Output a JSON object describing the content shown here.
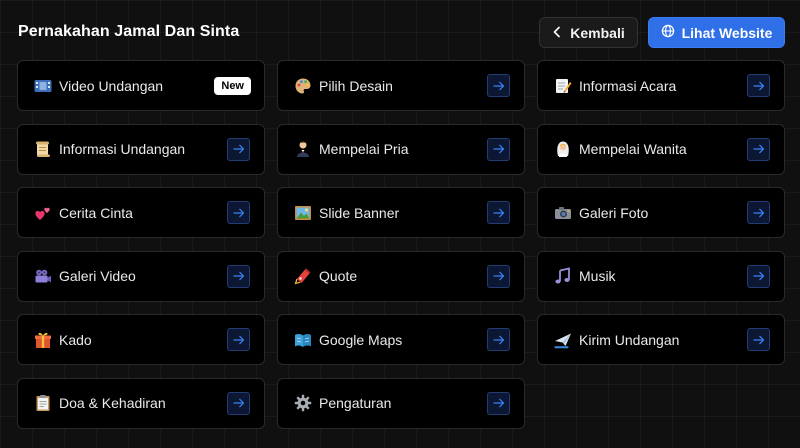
{
  "header": {
    "title": "Pernakahan Jamal Dan Sinta",
    "back_label": "Kembali",
    "website_label": "Lihat Website"
  },
  "colors": {
    "accent": "#2f6fe8",
    "arrow_icon": "#3b82f6",
    "card_background": "#000000"
  },
  "menu": [
    {
      "label": "Video Undangan",
      "icon": "film-icon",
      "badge": "New"
    },
    {
      "label": "Pilih Desain",
      "icon": "palette-icon"
    },
    {
      "label": "Informasi Acara",
      "icon": "memo-icon"
    },
    {
      "label": "Informasi Undangan",
      "icon": "scroll-icon"
    },
    {
      "label": "Mempelai Pria",
      "icon": "groom-icon"
    },
    {
      "label": "Mempelai Wanita",
      "icon": "bride-icon"
    },
    {
      "label": "Cerita Cinta",
      "icon": "hearts-icon"
    },
    {
      "label": "Slide Banner",
      "icon": "picture-icon"
    },
    {
      "label": "Galeri Foto",
      "icon": "camera-icon"
    },
    {
      "label": "Galeri Video",
      "icon": "video-camera-icon"
    },
    {
      "label": "Quote",
      "icon": "quote-icon"
    },
    {
      "label": "Musik",
      "icon": "music-note-icon"
    },
    {
      "label": "Kado",
      "icon": "gift-icon"
    },
    {
      "label": "Google Maps",
      "icon": "map-book-icon"
    },
    {
      "label": "Kirim Undangan",
      "icon": "send-plane-icon"
    },
    {
      "label": "Doa & Kehadiran",
      "icon": "clipboard-icon"
    },
    {
      "label": "Pengaturan",
      "icon": "gear-icon"
    }
  ]
}
